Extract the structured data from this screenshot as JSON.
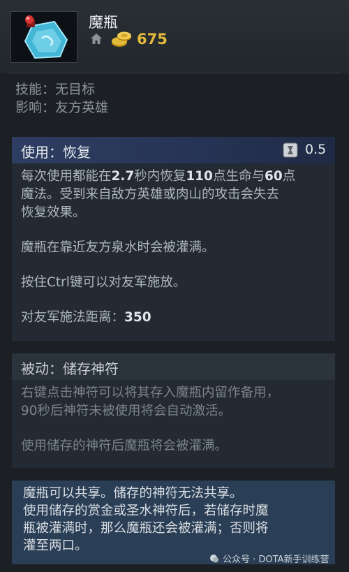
{
  "item": {
    "name": "魔瓶",
    "cost": "675",
    "icon": "magic-bottle-icon"
  },
  "meta": {
    "ability_line": "技能：无目标",
    "affects_line": "影响：友方英雄"
  },
  "active": {
    "title": "使用：恢复",
    "cooldown": "0.5",
    "line1_prefix": "每次使用都能在",
    "duration": "2.7",
    "line1_mid1": "秒内恢复",
    "health": "110",
    "line1_mid2": "点生命与",
    "mana": "60",
    "line1_suffix": "点",
    "line2": "魔法。受到来自敌方英雄或肉山的攻击会失去",
    "line3": "恢复效果。",
    "para2": "魔瓶在靠近友方泉水时会被灌满。",
    "para3": "按住Ctrl键可以对友军施放。",
    "range_label": "对友军施法距离：",
    "range_value": "350"
  },
  "passive": {
    "title": "被动：储存神符",
    "line1": "右键点击神符可以将其存入魔瓶内留作备用，",
    "line2": "90秒后神符未被使用将会自动激活。",
    "para2": "使用储存的神符后魔瓶将会被灌满。"
  },
  "note": {
    "line1": "魔瓶可以共享。储存的神符无法共享。",
    "line2": "使用储存的赏金或圣水神符后，若储存时魔",
    "line3": "瓶被灌满时，那么魔瓶还会被灌满；否则将",
    "line4": "灌至两口。"
  },
  "watermark": {
    "text": "公众号 · DOTA新手训练营"
  },
  "colors": {
    "gold": "#e3b93c",
    "active_header": "#2e3d62",
    "note_bg": "#2a3e55"
  }
}
